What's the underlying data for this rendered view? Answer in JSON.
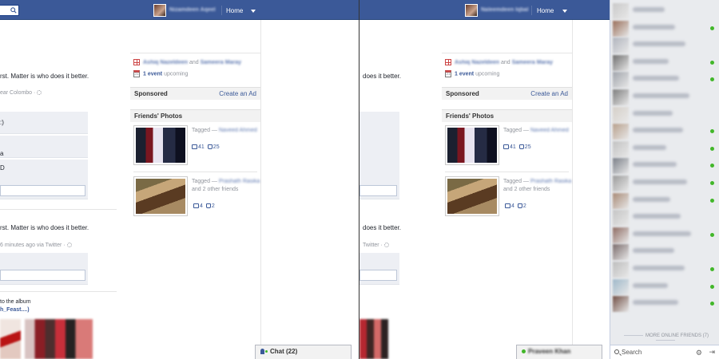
{
  "topbar": {
    "username_left": "Nizamdeen Aqeel",
    "username_right": "Naleemdeen Iqbal",
    "home_label": "Home"
  },
  "feed": {
    "post_text": "rst. Matter is who does it better.",
    "post_location": "ear Colombo ·",
    "comment_1": ":)",
    "comment_2": "a",
    "comment_3": "D",
    "post2_text": "rst. Matter is who does it better.",
    "post2_meta": "6 minutes ago via Twitter ·",
    "post2_meta_right": "Twitter ·",
    "album_line1": "to the album",
    "album_line2": "h_Feast....)"
  },
  "right_col": {
    "birthday_name1": "Ashiq Nazeldeen",
    "birthday_and": "and",
    "birthday_name2": "Sameera Maray",
    "event_count": "1 event",
    "event_suffix": "upcoming",
    "sponsored_label": "Sponsored",
    "create_ad_label": "Create an Ad",
    "friends_photos_label": "Friends' Photos",
    "photo1": {
      "tagged_prefix": "Tagged —",
      "tagged_name": "Naveed Ahmed",
      "comments": "41",
      "likes": "25"
    },
    "photo2": {
      "tagged_prefix": "Tagged —",
      "tagged_name": "Prashath Rasika",
      "tagged_suffix": "and 2 other friends",
      "comments": "4",
      "likes": "2"
    }
  },
  "chat": {
    "tab_label": "Chat (22)",
    "open_chat_name": "Praveen Khan",
    "more_friends_label": "MORE ONLINE FRIENDS (7)",
    "search_label": "Search"
  },
  "colors": {
    "topbar": "#3b5998",
    "link": "#3b5998",
    "online": "#42b72a"
  },
  "icons": [
    "search-icon",
    "caret-down-icon",
    "gift-icon",
    "calendar-icon",
    "comment-icon",
    "like-icon",
    "person-icon",
    "gear-icon",
    "popout-icon"
  ]
}
